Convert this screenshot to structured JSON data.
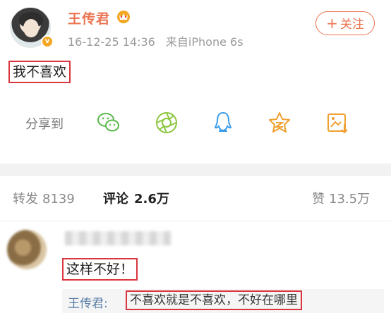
{
  "post": {
    "author": "王传君",
    "time": "16-12-25 14:36",
    "source": "来自iPhone 6s",
    "follow_label": "关注",
    "text": "我不喜欢"
  },
  "share": {
    "label": "分享到",
    "icons": [
      "wechat-icon",
      "moments-icon",
      "qq-icon",
      "qzone-icon",
      "save-image-icon"
    ]
  },
  "tabs": {
    "repost_label": "转发",
    "repost_count": "8139",
    "comment_label": "评论",
    "comment_count": "2.6万",
    "like_label": "赞",
    "like_count": "13.5万"
  },
  "comment": {
    "text": "这样不好！",
    "reply_author": "王传君:",
    "reply_text": "不喜欢就是不喜欢，不好在哪里"
  },
  "colors": {
    "accent": "#eb7350",
    "share_green": "#59b94b",
    "share_orange": "#f0a030",
    "highlight_box": "#d9363e",
    "link_blue": "#5b7fa8"
  }
}
